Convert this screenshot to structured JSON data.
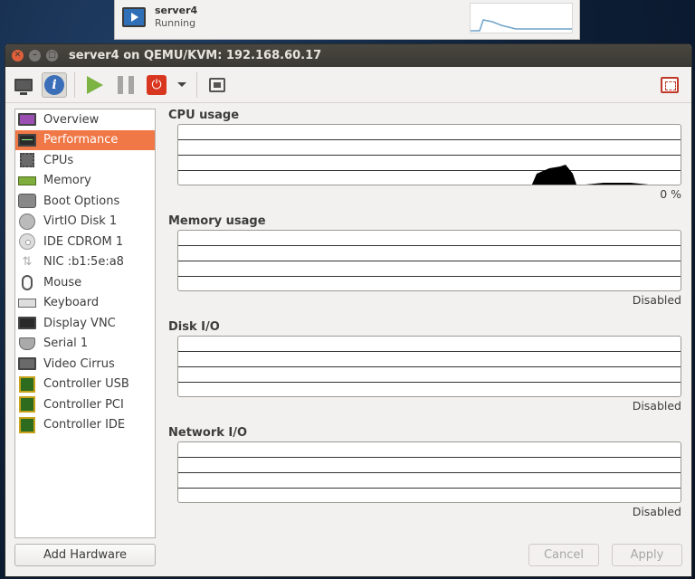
{
  "background_window": {
    "vm_name": "server4",
    "vm_status": "Running"
  },
  "window": {
    "title": "server4 on QEMU/KVM: 192.168.60.17"
  },
  "toolbar": {
    "icons": [
      "monitor-icon",
      "info-icon",
      "play-icon",
      "pause-icon",
      "power-icon",
      "dropdown-icon",
      "snapshot-icon",
      "fullscreen-icon"
    ]
  },
  "sidebar": {
    "items": [
      {
        "label": "Overview",
        "icon": "overview-icon"
      },
      {
        "label": "Performance",
        "icon": "performance-icon",
        "selected": true
      },
      {
        "label": "CPUs",
        "icon": "cpu-icon"
      },
      {
        "label": "Memory",
        "icon": "memory-icon"
      },
      {
        "label": "Boot Options",
        "icon": "boot-icon"
      },
      {
        "label": "VirtIO Disk 1",
        "icon": "disk-icon"
      },
      {
        "label": "IDE CDROM 1",
        "icon": "cdrom-icon"
      },
      {
        "label": "NIC :b1:5e:a8",
        "icon": "nic-icon"
      },
      {
        "label": "Mouse",
        "icon": "mouse-icon"
      },
      {
        "label": "Keyboard",
        "icon": "keyboard-icon"
      },
      {
        "label": "Display VNC",
        "icon": "display-icon"
      },
      {
        "label": "Serial 1",
        "icon": "serial-icon"
      },
      {
        "label": "Video Cirrus",
        "icon": "video-icon"
      },
      {
        "label": "Controller USB",
        "icon": "controller-icon"
      },
      {
        "label": "Controller PCI",
        "icon": "controller-icon"
      },
      {
        "label": "Controller IDE",
        "icon": "controller-icon"
      }
    ],
    "add_hardware": "Add Hardware"
  },
  "performance": {
    "cpu": {
      "title": "CPU usage",
      "value": "0 %"
    },
    "memory": {
      "title": "Memory usage",
      "value": "Disabled"
    },
    "disk": {
      "title": "Disk I/O",
      "value": "Disabled"
    },
    "network": {
      "title": "Network I/O",
      "value": "Disabled"
    }
  },
  "buttons": {
    "cancel": "Cancel",
    "apply": "Apply"
  },
  "colors": {
    "selection": "#f07746",
    "titlebar": "#3b3a35"
  }
}
